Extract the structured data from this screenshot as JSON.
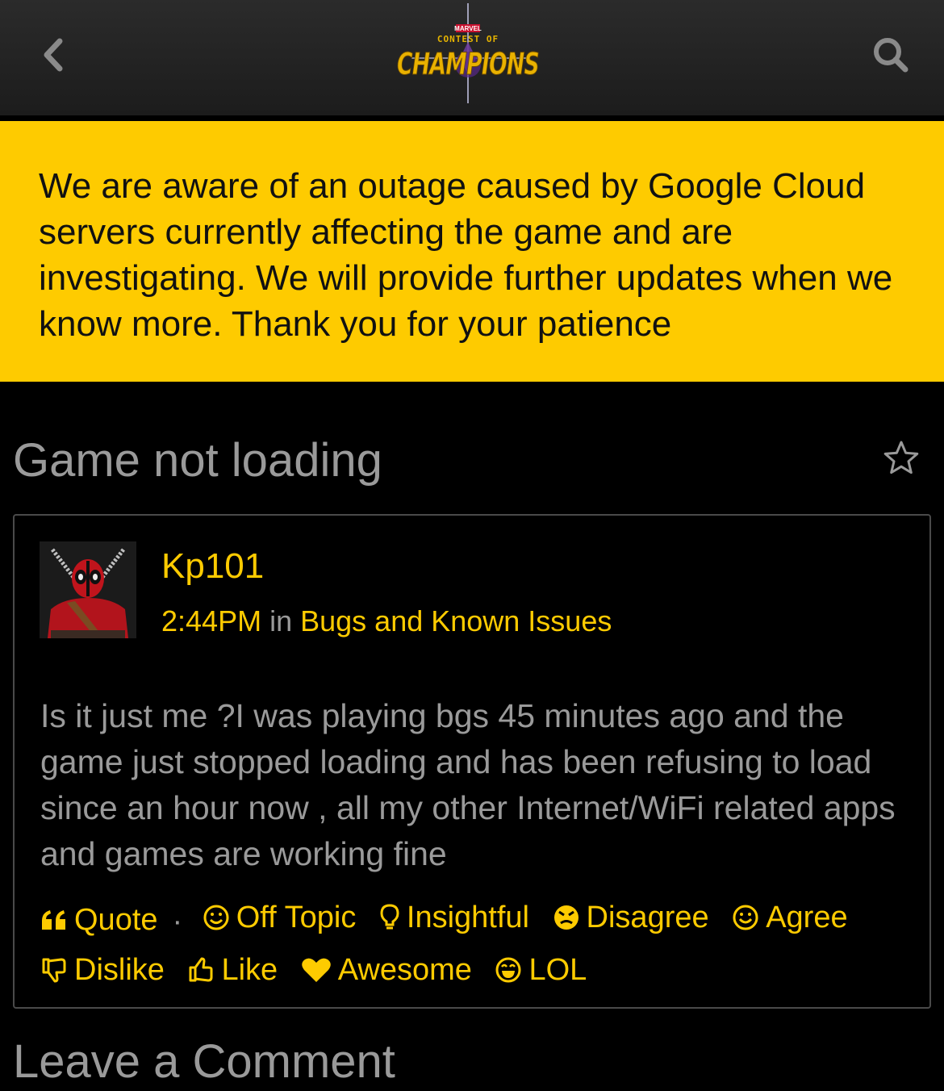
{
  "header": {
    "logo": {
      "brand": "MARVEL",
      "line1": "CONTEST OF",
      "line2": "CHAMPIONS"
    },
    "back_icon": "chevron-left-icon",
    "search_icon": "search-icon"
  },
  "banner": {
    "text": "We are aware of an outage caused by Google Cloud servers currently affecting the game and are investigating. We will provide further updates when we know more. Thank you for your patience",
    "color": "#fecb00"
  },
  "discussion": {
    "title": "Game not loading",
    "bookmark_icon": "star-icon"
  },
  "post": {
    "author": "Kp101",
    "time": "2:44PM",
    "in_label": " in ",
    "category": "Bugs and Known Issues",
    "body": "Is it just me ?I was playing bgs 45 minutes ago and the game just stopped loading and has been refusing to load since an hour now , all my other Internet/WiFi related apps and games are working fine",
    "quote_label": "Quote",
    "separator": "·",
    "reactions": [
      {
        "label": "Off Topic",
        "icon": "smile-icon"
      },
      {
        "label": "Insightful",
        "icon": "lightbulb-icon"
      },
      {
        "label": "Disagree",
        "icon": "angry-face-icon"
      },
      {
        "label": "Agree",
        "icon": "happy-face-icon"
      },
      {
        "label": "Dislike",
        "icon": "thumbs-down-icon"
      },
      {
        "label": "Like",
        "icon": "thumbs-up-icon"
      },
      {
        "label": "Awesome",
        "icon": "heart-icon"
      },
      {
        "label": "LOL",
        "icon": "laughing-face-icon"
      }
    ]
  },
  "comment_section": {
    "title": "Leave a Comment"
  },
  "colors": {
    "accent": "#fecb00",
    "muted_text": "#9a9a9a",
    "background": "#000000"
  }
}
